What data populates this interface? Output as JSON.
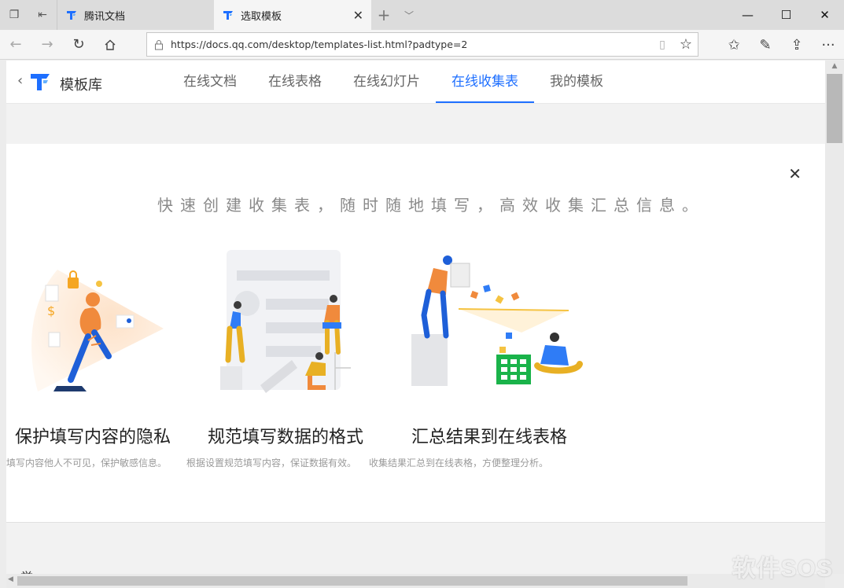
{
  "browser": {
    "tabs": [
      {
        "title": "腾讯文档",
        "active": false
      },
      {
        "title": "选取模板",
        "active": true
      }
    ],
    "url": "https://docs.qq.com/desktop/templates-list.html?padtype=2"
  },
  "page": {
    "brand": "模板库",
    "nav": [
      "在线文档",
      "在线表格",
      "在线幻灯片",
      "在线收集表",
      "我的模板"
    ],
    "active_nav": "在线收集表"
  },
  "card": {
    "intro": "快速创建收集表，随时随地填写，高效收集汇总信息。",
    "features": [
      {
        "title": "保护填写内容的隐私",
        "desc": "填写内容他人不可见，保护敏感信息。"
      },
      {
        "title": "规范填写数据的格式",
        "desc": "根据设置规范填写内容，保证数据有效。"
      },
      {
        "title": "汇总结果到在线表格",
        "desc": "收集结果汇总到在线表格，方便整理分析。"
      }
    ]
  },
  "below": {
    "text": "举一"
  },
  "watermark": "软件SOS",
  "colors": {
    "accent": "#1e6fff",
    "sheet_green": "#1ab34a"
  }
}
